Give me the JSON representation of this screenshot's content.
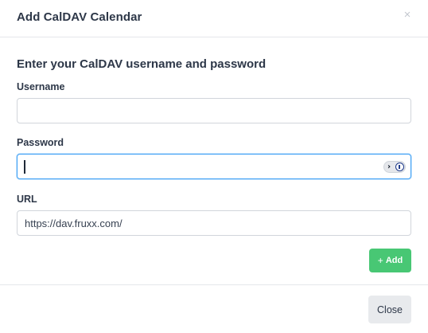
{
  "modal": {
    "title": "Add CalDAV Calendar",
    "close_icon": "close-icon"
  },
  "form": {
    "heading": "Enter your CalDAV username and password",
    "username": {
      "label": "Username",
      "value": "",
      "placeholder": ""
    },
    "password": {
      "label": "Password",
      "value": "",
      "placeholder": ""
    },
    "url": {
      "label": "URL",
      "value": "https://dav.fruxx.com/"
    },
    "password_manager_icon": "password-manager-icon"
  },
  "actions": {
    "add_label": "Add",
    "add_icon": "plus-icon",
    "close_label": "Close",
    "accent_color": "#48c774"
  }
}
